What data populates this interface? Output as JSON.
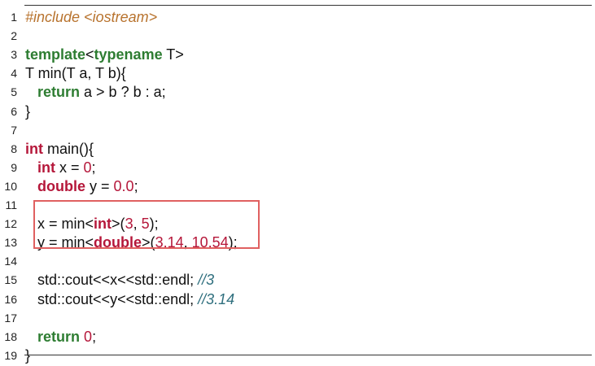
{
  "colors": {
    "keyword_green": "#2e7d32",
    "keyword_red": "#b5173a",
    "preprocessor": "#b8732e",
    "number": "#b5173a",
    "comment": "#2f6f7e",
    "plain": "#111111",
    "highlight_border": "#e06060"
  },
  "code_lines": [
    {
      "num": "1",
      "tokens": [
        {
          "text": "#include <iostream>",
          "kind": "pre"
        }
      ]
    },
    {
      "num": "2",
      "tokens": []
    },
    {
      "num": "3",
      "tokens": [
        {
          "text": "template",
          "kind": "kw_green"
        },
        {
          "text": "<",
          "kind": "plain"
        },
        {
          "text": "typename",
          "kind": "kw_green"
        },
        {
          "text": " T>",
          "kind": "plain"
        }
      ]
    },
    {
      "num": "4",
      "tokens": [
        {
          "text": "T min(T a, T b){",
          "kind": "plain"
        }
      ]
    },
    {
      "num": "5",
      "tokens": [
        {
          "text": "   ",
          "kind": "plain"
        },
        {
          "text": "return",
          "kind": "kw_green"
        },
        {
          "text": " a > b ? b : a;",
          "kind": "plain"
        }
      ]
    },
    {
      "num": "6",
      "tokens": [
        {
          "text": "}",
          "kind": "plain"
        }
      ]
    },
    {
      "num": "7",
      "tokens": []
    },
    {
      "num": "8",
      "tokens": [
        {
          "text": "int",
          "kind": "kw_red"
        },
        {
          "text": " main(){",
          "kind": "plain"
        }
      ]
    },
    {
      "num": "9",
      "tokens": [
        {
          "text": "   ",
          "kind": "plain"
        },
        {
          "text": "int",
          "kind": "kw_red"
        },
        {
          "text": " x = ",
          "kind": "plain"
        },
        {
          "text": "0",
          "kind": "num"
        },
        {
          "text": ";",
          "kind": "plain"
        }
      ]
    },
    {
      "num": "10",
      "tokens": [
        {
          "text": "   ",
          "kind": "plain"
        },
        {
          "text": "double",
          "kind": "kw_red"
        },
        {
          "text": " y = ",
          "kind": "plain"
        },
        {
          "text": "0.0",
          "kind": "num"
        },
        {
          "text": ";",
          "kind": "plain"
        }
      ]
    },
    {
      "num": "11",
      "tokens": []
    },
    {
      "num": "12",
      "tokens": [
        {
          "text": "   x = min<",
          "kind": "plain"
        },
        {
          "text": "int",
          "kind": "kw_red"
        },
        {
          "text": ">(",
          "kind": "plain"
        },
        {
          "text": "3",
          "kind": "num"
        },
        {
          "text": ", ",
          "kind": "plain"
        },
        {
          "text": "5",
          "kind": "num"
        },
        {
          "text": ");",
          "kind": "plain"
        }
      ]
    },
    {
      "num": "13",
      "tokens": [
        {
          "text": "   y = min<",
          "kind": "plain"
        },
        {
          "text": "double",
          "kind": "kw_red"
        },
        {
          "text": ">(",
          "kind": "plain"
        },
        {
          "text": "3.14",
          "kind": "num"
        },
        {
          "text": ", ",
          "kind": "plain"
        },
        {
          "text": "10.54",
          "kind": "num"
        },
        {
          "text": ");",
          "kind": "plain"
        }
      ]
    },
    {
      "num": "14",
      "tokens": []
    },
    {
      "num": "15",
      "tokens": [
        {
          "text": "   std::cout<<x<<std::endl; ",
          "kind": "plain"
        },
        {
          "text": "//3",
          "kind": "cmt"
        }
      ]
    },
    {
      "num": "16",
      "tokens": [
        {
          "text": "   std::cout<<y<<std::endl; ",
          "kind": "plain"
        },
        {
          "text": "//3.14",
          "kind": "cmt"
        }
      ]
    },
    {
      "num": "17",
      "tokens": []
    },
    {
      "num": "18",
      "tokens": [
        {
          "text": "   ",
          "kind": "plain"
        },
        {
          "text": "return",
          "kind": "kw_green"
        },
        {
          "text": " ",
          "kind": "plain"
        },
        {
          "text": "0",
          "kind": "num"
        },
        {
          "text": ";",
          "kind": "plain"
        }
      ]
    },
    {
      "num": "19",
      "tokens": [
        {
          "text": "}",
          "kind": "plain"
        }
      ]
    }
  ]
}
